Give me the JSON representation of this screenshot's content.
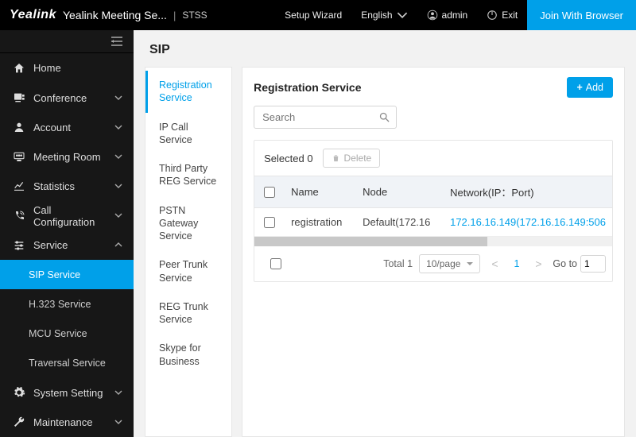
{
  "topbar": {
    "brand": "Yealink",
    "title": "Yealink Meeting Se...",
    "subtitle": "STSS",
    "setup": "Setup Wizard",
    "language": "English",
    "user": "admin",
    "exit": "Exit",
    "join": "Join With Browser"
  },
  "sidebar": {
    "items": [
      {
        "label": "Home",
        "icon": "home",
        "expandable": false
      },
      {
        "label": "Conference",
        "icon": "conference",
        "expandable": true
      },
      {
        "label": "Account",
        "icon": "account",
        "expandable": true
      },
      {
        "label": "Meeting Room",
        "icon": "meeting",
        "expandable": true
      },
      {
        "label": "Statistics",
        "icon": "stats",
        "expandable": true
      },
      {
        "label": "Call Configuration",
        "icon": "callcfg",
        "expandable": true
      },
      {
        "label": "Service",
        "icon": "service",
        "expandable": true,
        "expanded": true,
        "children": [
          {
            "label": "SIP Service",
            "active": true
          },
          {
            "label": "H.323 Service"
          },
          {
            "label": "MCU Service"
          },
          {
            "label": "Traversal Service"
          }
        ]
      },
      {
        "label": "System Setting",
        "icon": "gear",
        "expandable": true
      },
      {
        "label": "Maintenance",
        "icon": "wrench",
        "expandable": true
      }
    ]
  },
  "page": {
    "title": "SIP",
    "subnav": [
      {
        "label": "Registration Service",
        "active": true
      },
      {
        "label": "IP Call Service"
      },
      {
        "label": "Third Party REG Service"
      },
      {
        "label": "PSTN Gateway Service"
      },
      {
        "label": "Peer Trunk Service"
      },
      {
        "label": "REG Trunk Service"
      },
      {
        "label": "Skype for Business"
      }
    ]
  },
  "content": {
    "title": "Registration Service",
    "add_label": "Add",
    "search_placeholder": "Search",
    "selected_prefix": "Selected",
    "selected_count": 0,
    "delete_label": "Delete",
    "columns": {
      "name": "Name",
      "node": "Node",
      "network": "Network(IP：Port)"
    },
    "rows": [
      {
        "name": "registration",
        "node": "Default(172.16",
        "network": "172.16.16.149(172.16.16.149:506"
      }
    ],
    "pagination": {
      "total_label": "Total 1",
      "per_page": "10/page",
      "current": 1,
      "goto_label": "Go to",
      "goto_value": "1"
    }
  }
}
